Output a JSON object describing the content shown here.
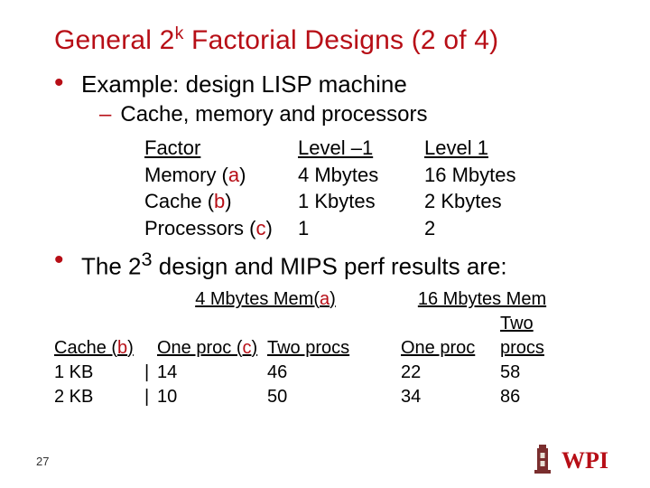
{
  "title": {
    "pre": "General 2",
    "sup": "k",
    "post": " Factorial Designs (2 of 4)"
  },
  "bullet1": "Example: design LISP machine",
  "sub1": "Cache, memory and processors",
  "factors": {
    "header": {
      "c1": "Factor",
      "c2": "Level –1",
      "c3": "Level 1"
    },
    "rows": [
      {
        "name_pre": "Memory (",
        "tag": "a",
        "name_post": ")",
        "lo": "4 Mbytes",
        "hi": "16 Mbytes"
      },
      {
        "name_pre": "Cache (",
        "tag": "b",
        "name_post": ")",
        "lo": "1 Kbytes",
        "hi": "2 Kbytes"
      },
      {
        "name_pre": "Processors (",
        "tag": "c",
        "name_post": ")",
        "lo": "1",
        "hi": "2"
      }
    ]
  },
  "bullet2": {
    "pre": "The 2",
    "sup": "3",
    "post": " design and MIPS perf results are:"
  },
  "results": {
    "group1": {
      "pre": "4 Mbytes Mem(",
      "tag": "a",
      "post": ")"
    },
    "group2": "16 Mbytes Mem",
    "cache_hdr": {
      "pre": "Cache (",
      "tag": "b",
      "post": ")"
    },
    "col_1proc": {
      "pre": "One proc (",
      "tag": "c",
      "post": ")"
    },
    "col_2proc": "Two procs",
    "col_1proc_b": "One proc",
    "col_2proc_b": "Two procs",
    "rows": [
      {
        "cache": "1 KB",
        "a1": "14",
        "a2": "46",
        "b1": "22",
        "b2": "58"
      },
      {
        "cache": "2 KB",
        "a1": "10",
        "a2": "50",
        "b1": "34",
        "b2": "86"
      }
    ]
  },
  "page_number": "27",
  "chart_data": {
    "type": "table",
    "title": "2^3 factorial design — MIPS performance",
    "factors": [
      {
        "name": "Memory",
        "tag": "a",
        "level_-1": "4 Mbytes",
        "level_1": "16 Mbytes"
      },
      {
        "name": "Cache",
        "tag": "b",
        "level_-1": "1 Kbytes",
        "level_1": "2 Kbytes"
      },
      {
        "name": "Processors",
        "tag": "c",
        "level_-1": 1,
        "level_1": 2
      }
    ],
    "responses": [
      {
        "mem": "4 Mbytes",
        "cache": "1 KB",
        "procs": 1,
        "mips": 14
      },
      {
        "mem": "4 Mbytes",
        "cache": "1 KB",
        "procs": 2,
        "mips": 46
      },
      {
        "mem": "4 Mbytes",
        "cache": "2 KB",
        "procs": 1,
        "mips": 10
      },
      {
        "mem": "4 Mbytes",
        "cache": "2 KB",
        "procs": 2,
        "mips": 50
      },
      {
        "mem": "16 Mbytes",
        "cache": "1 KB",
        "procs": 1,
        "mips": 22
      },
      {
        "mem": "16 Mbytes",
        "cache": "1 KB",
        "procs": 2,
        "mips": 58
      },
      {
        "mem": "16 Mbytes",
        "cache": "2 KB",
        "procs": 1,
        "mips": 34
      },
      {
        "mem": "16 Mbytes",
        "cache": "2 KB",
        "procs": 2,
        "mips": 86
      }
    ]
  }
}
